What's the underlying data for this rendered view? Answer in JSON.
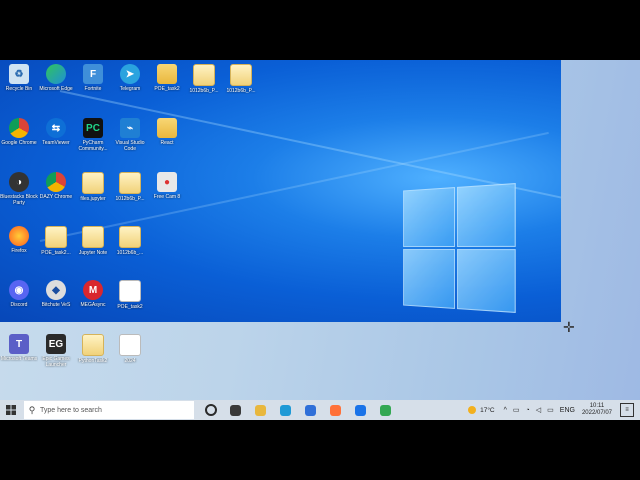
{
  "desktop": {
    "icons": [
      {
        "label": "Recycle Bin",
        "icon": "recycle-bin-icon"
      },
      {
        "label": "Microsoft Edge",
        "icon": "edge-icon"
      },
      {
        "label": "Fortnite",
        "icon": "fortnite-icon"
      },
      {
        "label": "Telegram",
        "icon": "telegram-icon"
      },
      {
        "label": "POE_task2",
        "icon": "folder-icon"
      },
      {
        "label": "1012b6b_P...",
        "icon": "document-icon"
      },
      {
        "label": "1012b6b_P...",
        "icon": "document-icon"
      },
      {
        "label": "Google Chrome",
        "icon": "chrome-icon"
      },
      {
        "label": "TeamViewer",
        "icon": "teamviewer-icon"
      },
      {
        "label": "PyCharm Community...",
        "icon": "pycharm-icon"
      },
      {
        "label": "Visual Studio Code",
        "icon": "vscode-icon"
      },
      {
        "label": "React",
        "icon": "folder-icon"
      },
      {
        "label": "Bluestacks Block Party",
        "icon": "bluestacks-icon"
      },
      {
        "label": "DAZY Chrome",
        "icon": "chrome-icon"
      },
      {
        "label": "files.jupyter",
        "icon": "document-icon"
      },
      {
        "label": "1012b6b_P...",
        "icon": "document-icon"
      },
      {
        "label": "Free Cam 8",
        "icon": "freecam-icon"
      },
      {
        "label": "Firefox",
        "icon": "firefox-icon"
      },
      {
        "label": "POE_task2...",
        "icon": "document-icon"
      },
      {
        "label": "Jupyter Note",
        "icon": "document-icon"
      },
      {
        "label": "1012b6b_...",
        "icon": "document-icon"
      },
      {
        "label": "Discord",
        "icon": "discord-icon"
      },
      {
        "label": "Bitchute VeS",
        "icon": "bitchute-icon"
      },
      {
        "label": "MEGAsync",
        "icon": "mega-icon"
      },
      {
        "label": "POE_task2",
        "icon": "document-white-icon"
      },
      {
        "label": "Microsoft Teams",
        "icon": "teams-icon"
      },
      {
        "label": "Epic Games Launcher",
        "icon": "epic-games-icon"
      },
      {
        "label": "PythonTask2",
        "icon": "document-icon"
      },
      {
        "label": "2024",
        "icon": "document-white-icon"
      }
    ]
  },
  "taskbar": {
    "search_placeholder": "Type here to search",
    "apps": [
      {
        "name": "cortana",
        "color": "#2b2b2b"
      },
      {
        "name": "task-view",
        "color": "#3a3a3a"
      },
      {
        "name": "file-explorer",
        "color": "#e8b73d"
      },
      {
        "name": "edge",
        "color": "#1f9ad6"
      },
      {
        "name": "store",
        "color": "#2f6fd8"
      },
      {
        "name": "firefox",
        "color": "#ff7139"
      },
      {
        "name": "mail",
        "color": "#1a73e8"
      },
      {
        "name": "chrome",
        "color": "#34a853"
      }
    ],
    "weather": "17°C",
    "language": "ENG",
    "time": "10:11",
    "date": "2022/07/07"
  }
}
